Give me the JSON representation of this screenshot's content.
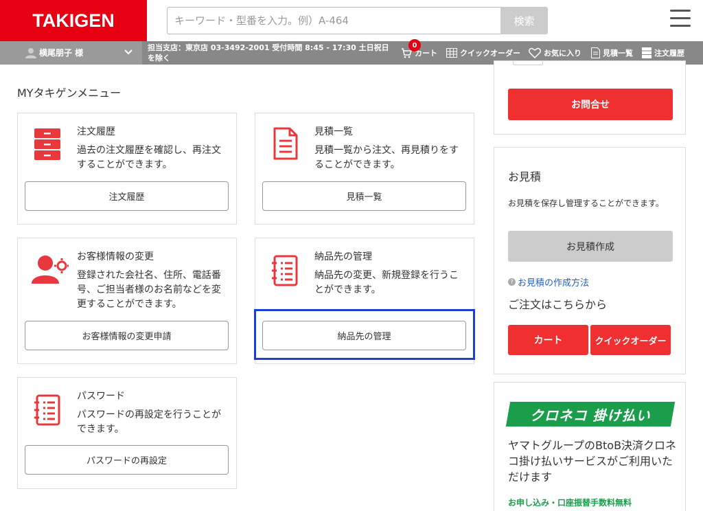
{
  "header": {
    "logo": "TAKIGEN",
    "search_placeholder": "キーワード・型番を入力。例）A-464",
    "search_button": "検索"
  },
  "subbar": {
    "user_name": "横尾朋子 様",
    "branch_info": "担当支店：東京店 03-3492-2001 受付時間 8:45 - 17:30 土日祝日を除く",
    "cart_count": "0",
    "cart": "カート",
    "quick_order": "クイックオーダー",
    "favorites": "お気に入り",
    "quotes": "見積一覧",
    "order_history": "注文履歴"
  },
  "main": {
    "section_title": "MYタキゲンメニュー",
    "cards": [
      {
        "title": "注文履歴",
        "desc": "過去の注文履歴を確認し、再注文することができます。",
        "button": "注文履歴"
      },
      {
        "title": "見積一覧",
        "desc": "見積一覧から注文、再見積りをすることができます。",
        "button": "見積一覧"
      },
      {
        "title": "お客様情報の変更",
        "desc": "登録された会社名、住所、電話番号、ご担当者様のお名前などを変更することができます。",
        "button": "お客様情報の変更申請"
      },
      {
        "title": "納品先の管理",
        "desc": "納品先の変更、新規登録を行うことができます。",
        "button": "納品先の管理"
      },
      {
        "title": "パスワード",
        "desc": "パスワードの再設定を行うことができます。",
        "button": "パスワードの再設定"
      }
    ]
  },
  "sidebar": {
    "inquiry_button": "お問合せ",
    "quote_title": "お見積",
    "quote_desc": "お見積を保存し管理することができます。",
    "quote_create_button": "お見積作成",
    "quote_howto_link": "お見積の作成方法",
    "order_title": "ご注文はこちらから",
    "cart_button": "カート",
    "quick_order_button": "クイックオーダー",
    "kuroneko_logo": "クロネコ 掛け払い",
    "kuroneko_desc": "ヤマトグループのBtoB決済クロネコ掛け払いサービスがご利用いただけます",
    "kuroneko_note": "お申し込み・口座振替手数料無料"
  },
  "colors": {
    "brand_red": "#e60012",
    "button_red": "#f03030",
    "highlight_blue": "#1a3fd6",
    "kuroneko_green": "#1b9e4b"
  }
}
